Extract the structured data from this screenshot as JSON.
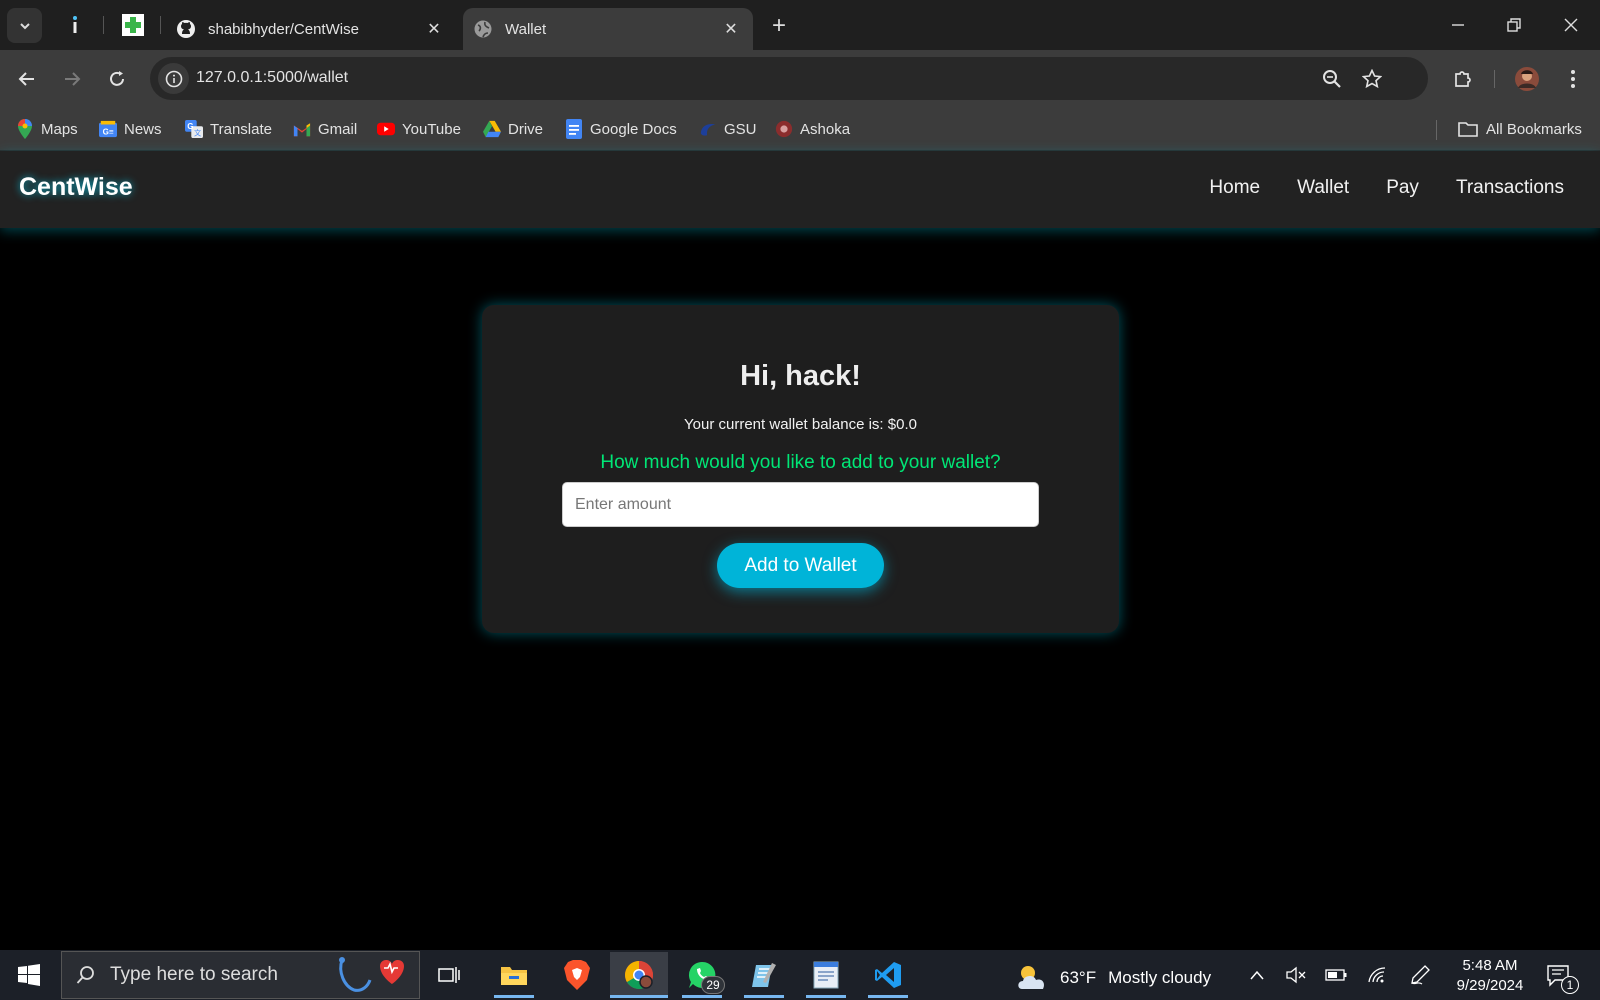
{
  "browser": {
    "tabs": [
      {
        "title": "shabibhyder/CentWise",
        "close": "✕"
      },
      {
        "title": "Wallet",
        "close": "✕"
      }
    ],
    "new_tab": "+",
    "url": "127.0.0.1:5000/wallet",
    "bookmarks": [
      {
        "label": "Maps",
        "icon": "maps-icon"
      },
      {
        "label": "News",
        "icon": "news-icon"
      },
      {
        "label": "Translate",
        "icon": "translate-icon"
      },
      {
        "label": "Gmail",
        "icon": "gmail-icon"
      },
      {
        "label": "YouTube",
        "icon": "youtube-icon"
      },
      {
        "label": "Drive",
        "icon": "drive-icon"
      },
      {
        "label": "Google Docs",
        "icon": "docs-icon"
      },
      {
        "label": "GSU",
        "icon": "gsu-icon"
      },
      {
        "label": "Ashoka",
        "icon": "ashoka-icon"
      }
    ],
    "all_bookmarks": "All Bookmarks"
  },
  "app": {
    "brand": "CentWise",
    "nav": [
      "Home",
      "Wallet",
      "Pay",
      "Transactions"
    ],
    "greeting": "Hi, hack!",
    "balance_text": "Your current wallet balance is: $0.0",
    "question": "How much would you like to add to your wallet?",
    "amount_placeholder": "Enter amount",
    "submit_label": "Add to Wallet",
    "colors": {
      "accent": "#00b4d8",
      "question": "#00e676",
      "card": "#1e1e1e",
      "navbar": "#222222"
    }
  },
  "taskbar": {
    "search_placeholder": "Type here to search",
    "whatsapp_badge": "29",
    "weather_temp": "63°F",
    "weather_desc": "Mostly cloudy",
    "time": "5:48 AM",
    "date": "9/29/2024",
    "notification_count": "1"
  }
}
